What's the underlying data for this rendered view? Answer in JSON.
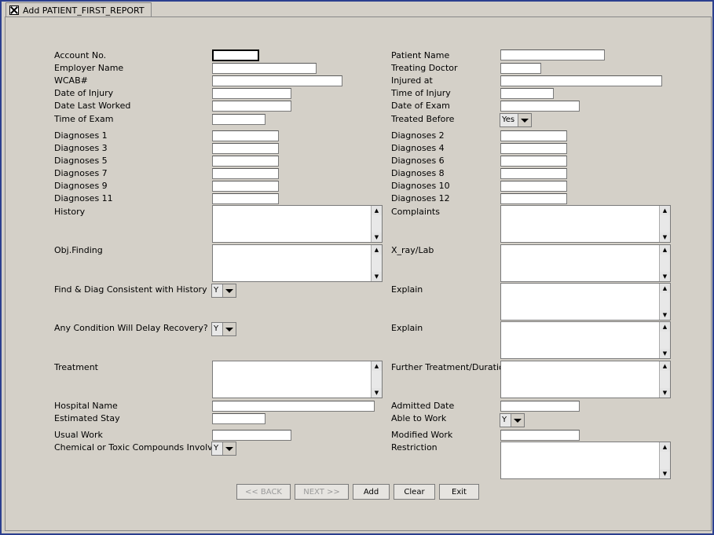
{
  "window": {
    "title": "Add PATIENT_FIRST_REPORT"
  },
  "left": {
    "account_no": "Account No.",
    "employer_name": "Employer Name",
    "wcab": "WCAB#",
    "date_of_injury": "Date of Injury",
    "date_last_worked": "Date Last Worked",
    "time_of_exam": "Time of Exam",
    "diag1": "Diagnoses 1",
    "diag3": "Diagnoses 3",
    "diag5": "Diagnoses 5",
    "diag7": "Diagnoses 7",
    "diag9": "Diagnoses 9",
    "diag11": "Diagnoses 11",
    "history": "History",
    "obj_finding": "Obj.Finding",
    "find_diag": "Find & Diag Consistent with History",
    "delay_recovery": "Any Condition Will Delay Recovery?",
    "treatment": "Treatment",
    "hospital_name": "Hospital Name",
    "estimated_stay": "Estimated Stay",
    "usual_work": "Usual Work",
    "chemical": "Chemical or Toxic Compounds Involved"
  },
  "right": {
    "patient_name": "Patient Name",
    "treating_doctor": "Treating Doctor",
    "injured_at": "Injured at",
    "time_of_injury": "Time of Injury",
    "date_of_exam": "Date of Exam",
    "treated_before": "Treated Before",
    "diag2": "Diagnoses 2",
    "diag4": "Diagnoses 4",
    "diag6": "Diagnoses 6",
    "diag8": "Diagnoses 8",
    "diag10": "Diagnoses 10",
    "diag12": "Diagnoses 12",
    "complaints": "Complaints",
    "xray_lab": "X_ray/Lab",
    "explain1": "Explain",
    "explain2": "Explain",
    "further_treatment": "Further Treatment/Duration",
    "admitted_date": "Admitted Date",
    "able_to_work": "Able to Work",
    "modified_work": "Modified Work",
    "restriction": "Restriction"
  },
  "combos": {
    "treated_before": "Yes",
    "find_diag": "Y",
    "delay_recovery": "Y",
    "able_to_work": "Y",
    "chemical": "Y"
  },
  "buttons": {
    "back": "<< BACK",
    "next": "NEXT >>",
    "add": "Add",
    "clear": "Clear",
    "exit": "Exit"
  }
}
